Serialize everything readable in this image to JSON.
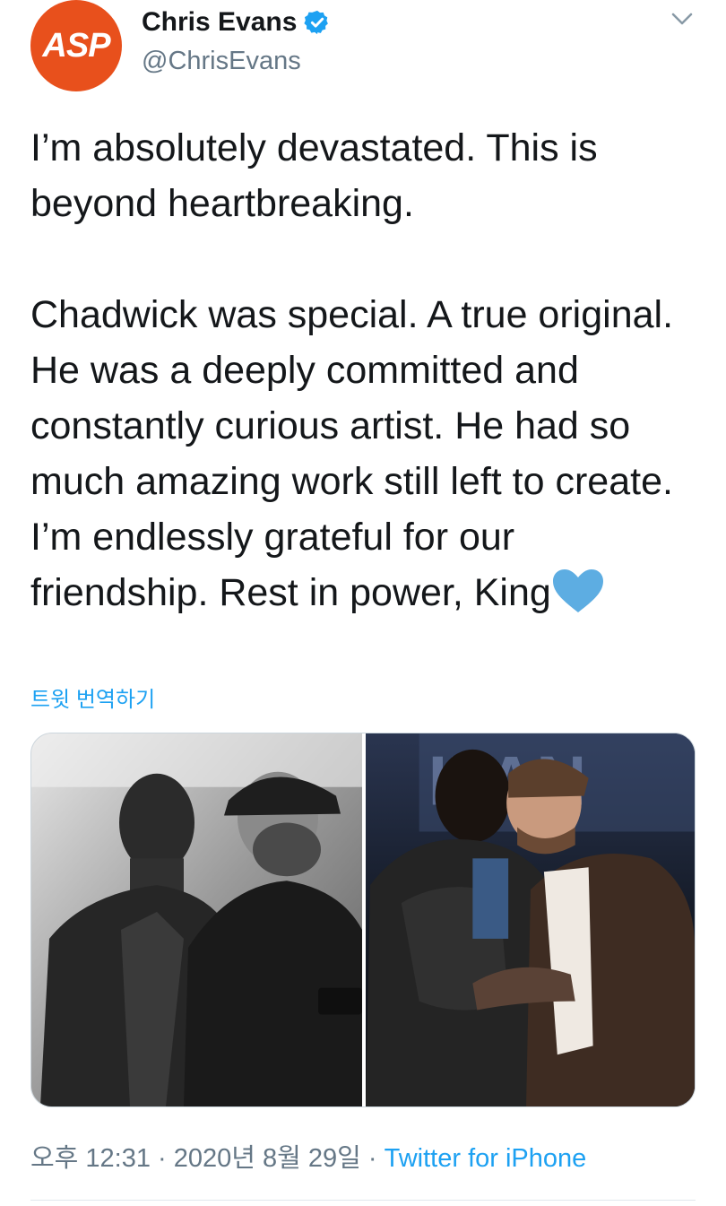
{
  "author": {
    "avatar_text": "ASP",
    "display_name": "Chris Evans",
    "handle": "@ChrisEvans"
  },
  "tweet": {
    "text": "I’m absolutely devastated. This is beyond heartbreaking.\n\nChadwick was special. A true original. He was a deeply committed and constantly curious artist. He had so much amazing work still left to create. I’m endlessly grateful for our friendship. Rest in power, King",
    "translate_label": "트윗 번역하기"
  },
  "media": {
    "photos": [
      "bw-photo-chadwick-and-chris",
      "color-photo-embrace-on-stage"
    ]
  },
  "meta": {
    "time": "오후 12:31",
    "separator1": " · ",
    "date": "2020년 8월 29일",
    "separator2": " · ",
    "source": "Twitter for iPhone"
  },
  "colors": {
    "accent": "#1da1f2",
    "avatar_bg": "#e8501c",
    "heart": "#5dade2"
  }
}
